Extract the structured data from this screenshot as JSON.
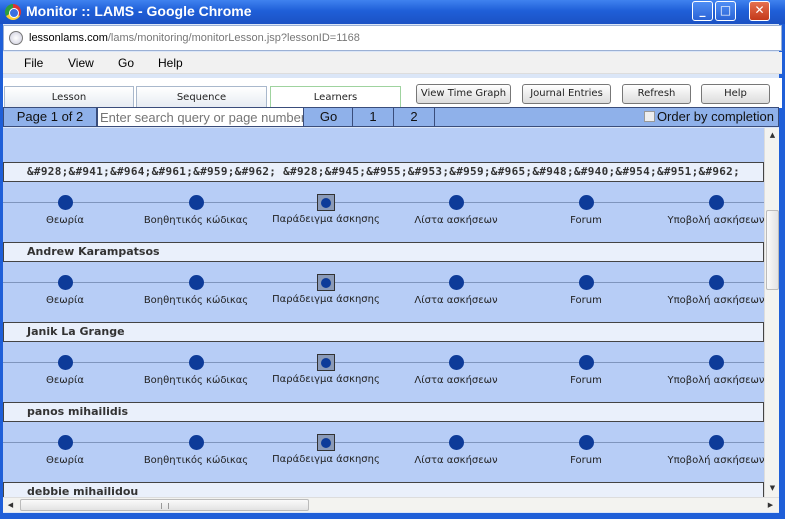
{
  "window": {
    "title": "Monitor :: LAMS - Google Chrome",
    "controls": {
      "minimize": "_",
      "maximize": "□",
      "close": "✕"
    }
  },
  "address": {
    "domain": "lessonlams.com",
    "path": "/lams/monitoring/monitorLesson.jsp?lessonID=1168"
  },
  "menu": [
    "File",
    "View",
    "Go",
    "Help"
  ],
  "tabs": [
    {
      "label": "Lesson",
      "active": false
    },
    {
      "label": "Sequence",
      "active": false
    },
    {
      "label": "Learners",
      "active": true
    }
  ],
  "buttons": {
    "time_graph": "View Time Graph",
    "journal": "Journal Entries",
    "refresh": "Refresh",
    "help": "Help"
  },
  "pager": {
    "page_label": "Page 1 of 2",
    "search_placeholder": "Enter search query or page number",
    "go": "Go",
    "pages": [
      "1",
      "2"
    ],
    "order_label": "Order by completion",
    "order_checked": false
  },
  "activities": [
    "Θεωρία",
    "Βοηθητικός κώδικας",
    "Παράδειγμα άσκησης",
    "Λίστα ασκήσεων",
    "Forum",
    "Υποβολή ασκήσεων"
  ],
  "current_activity_index": 2,
  "learners": [
    {
      "name": "&#928;&#941;&#964;&#961;&#959;&#962; &#928;&#945;&#955;&#953;&#959;&#965;&#948;&#940;&#954;&#951;&#962;"
    },
    {
      "name": "Andrew Karampatsos"
    },
    {
      "name": "Janik La Grange"
    },
    {
      "name": "panos mihailidis"
    },
    {
      "name": "debbie mihailidou"
    }
  ],
  "colors": {
    "titlebar": "#1f5fd8",
    "content_bg": "#b7cdf6",
    "pager_bg": "#8fb1ea",
    "activity_dot": "#0d3b99"
  },
  "icons": {
    "browser": "chrome-icon",
    "site": "globe-icon"
  }
}
